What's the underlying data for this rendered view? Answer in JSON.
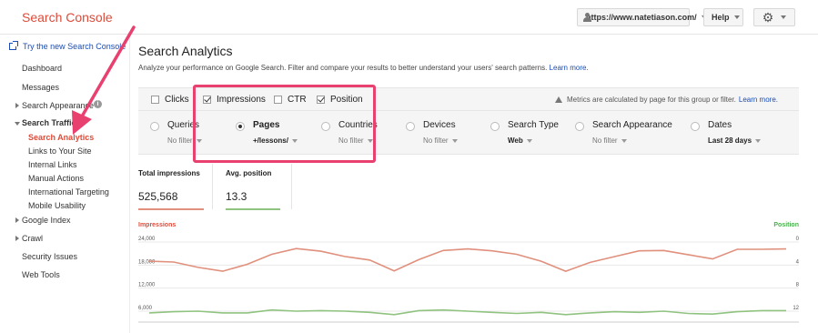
{
  "header": {
    "brand": "Search Console",
    "site": "https://www.natetiason.com/",
    "help": "Help",
    "gear_icon": "gear-icon"
  },
  "sidebar": {
    "try_new": "Try the new Search Console",
    "dashboard": "Dashboard",
    "messages": "Messages",
    "search_appearance": "Search Appearance",
    "search_traffic": "Search Traffic",
    "sub_items": [
      "Search Analytics",
      "Links to Your Site",
      "Internal Links",
      "Manual Actions",
      "International Targeting",
      "Mobile Usability"
    ],
    "google_index": "Google Index",
    "crawl": "Crawl",
    "security_issues": "Security Issues",
    "web_tools": "Web Tools"
  },
  "main": {
    "title": "Search Analytics",
    "description": "Analyze your performance on Google Search. Filter and compare your results to better understand your users' search patterns.",
    "learn_more": "Learn more."
  },
  "metrics": {
    "items": [
      {
        "label": "Clicks",
        "checked": false
      },
      {
        "label": "Impressions",
        "checked": true
      },
      {
        "label": "CTR",
        "checked": false
      },
      {
        "label": "Position",
        "checked": true
      }
    ],
    "note": "Metrics are calculated by page for this group or filter.",
    "note_link": "Learn more."
  },
  "dimensions": [
    {
      "label": "Queries",
      "value": "No filter",
      "selected": false
    },
    {
      "label": "Pages",
      "value": "+/lessons/",
      "selected": true
    },
    {
      "label": "Countries",
      "value": "No filter",
      "selected": false
    },
    {
      "label": "Devices",
      "value": "No filter",
      "selected": false
    },
    {
      "label": "Search Type",
      "value": "Web",
      "selected": false
    },
    {
      "label": "Search Appearance",
      "value": "No filter",
      "selected": false
    },
    {
      "label": "Dates",
      "value": "Last 28 days",
      "selected": false
    }
  ],
  "stats": {
    "total_impressions_label": "Total impressions",
    "total_impressions_value": "525,568",
    "avg_position_label": "Avg. position",
    "avg_position_value": "13.3"
  },
  "colors": {
    "impressions": "#e0907c",
    "position": "#8fc37f",
    "highlight": "#e8416f",
    "brand": "#dd4b39"
  },
  "chart_data": {
    "type": "line",
    "left_axis_title": "Impressions",
    "right_axis_title": "Position",
    "left_ticks": [
      "24,000",
      "18,000",
      "12,000",
      "6,000"
    ],
    "right_ticks": [
      "0",
      "4",
      "8",
      "12"
    ],
    "left_ylim": [
      0,
      24000
    ],
    "right_ylim": [
      0,
      16
    ],
    "series": [
      {
        "name": "Impressions",
        "axis": "left",
        "values": [
          19000,
          18800,
          17400,
          16400,
          18200,
          20800,
          22300,
          21600,
          20200,
          19300,
          16500,
          19400,
          21800,
          22200,
          21700,
          20800,
          19000,
          16400,
          18700,
          20200,
          21700,
          21800,
          20700,
          19600,
          22100,
          22100,
          22200
        ]
      },
      {
        "name": "Position",
        "axis": "right",
        "values": [
          12.3,
          12.1,
          12.0,
          12.3,
          12.3,
          11.8,
          12.0,
          11.9,
          12.0,
          12.2,
          12.6,
          11.9,
          11.8,
          12.0,
          12.2,
          12.4,
          12.2,
          12.6,
          12.3,
          12.1,
          12.2,
          12.0,
          12.4,
          12.5,
          12.1,
          11.9,
          11.9
        ]
      }
    ]
  }
}
